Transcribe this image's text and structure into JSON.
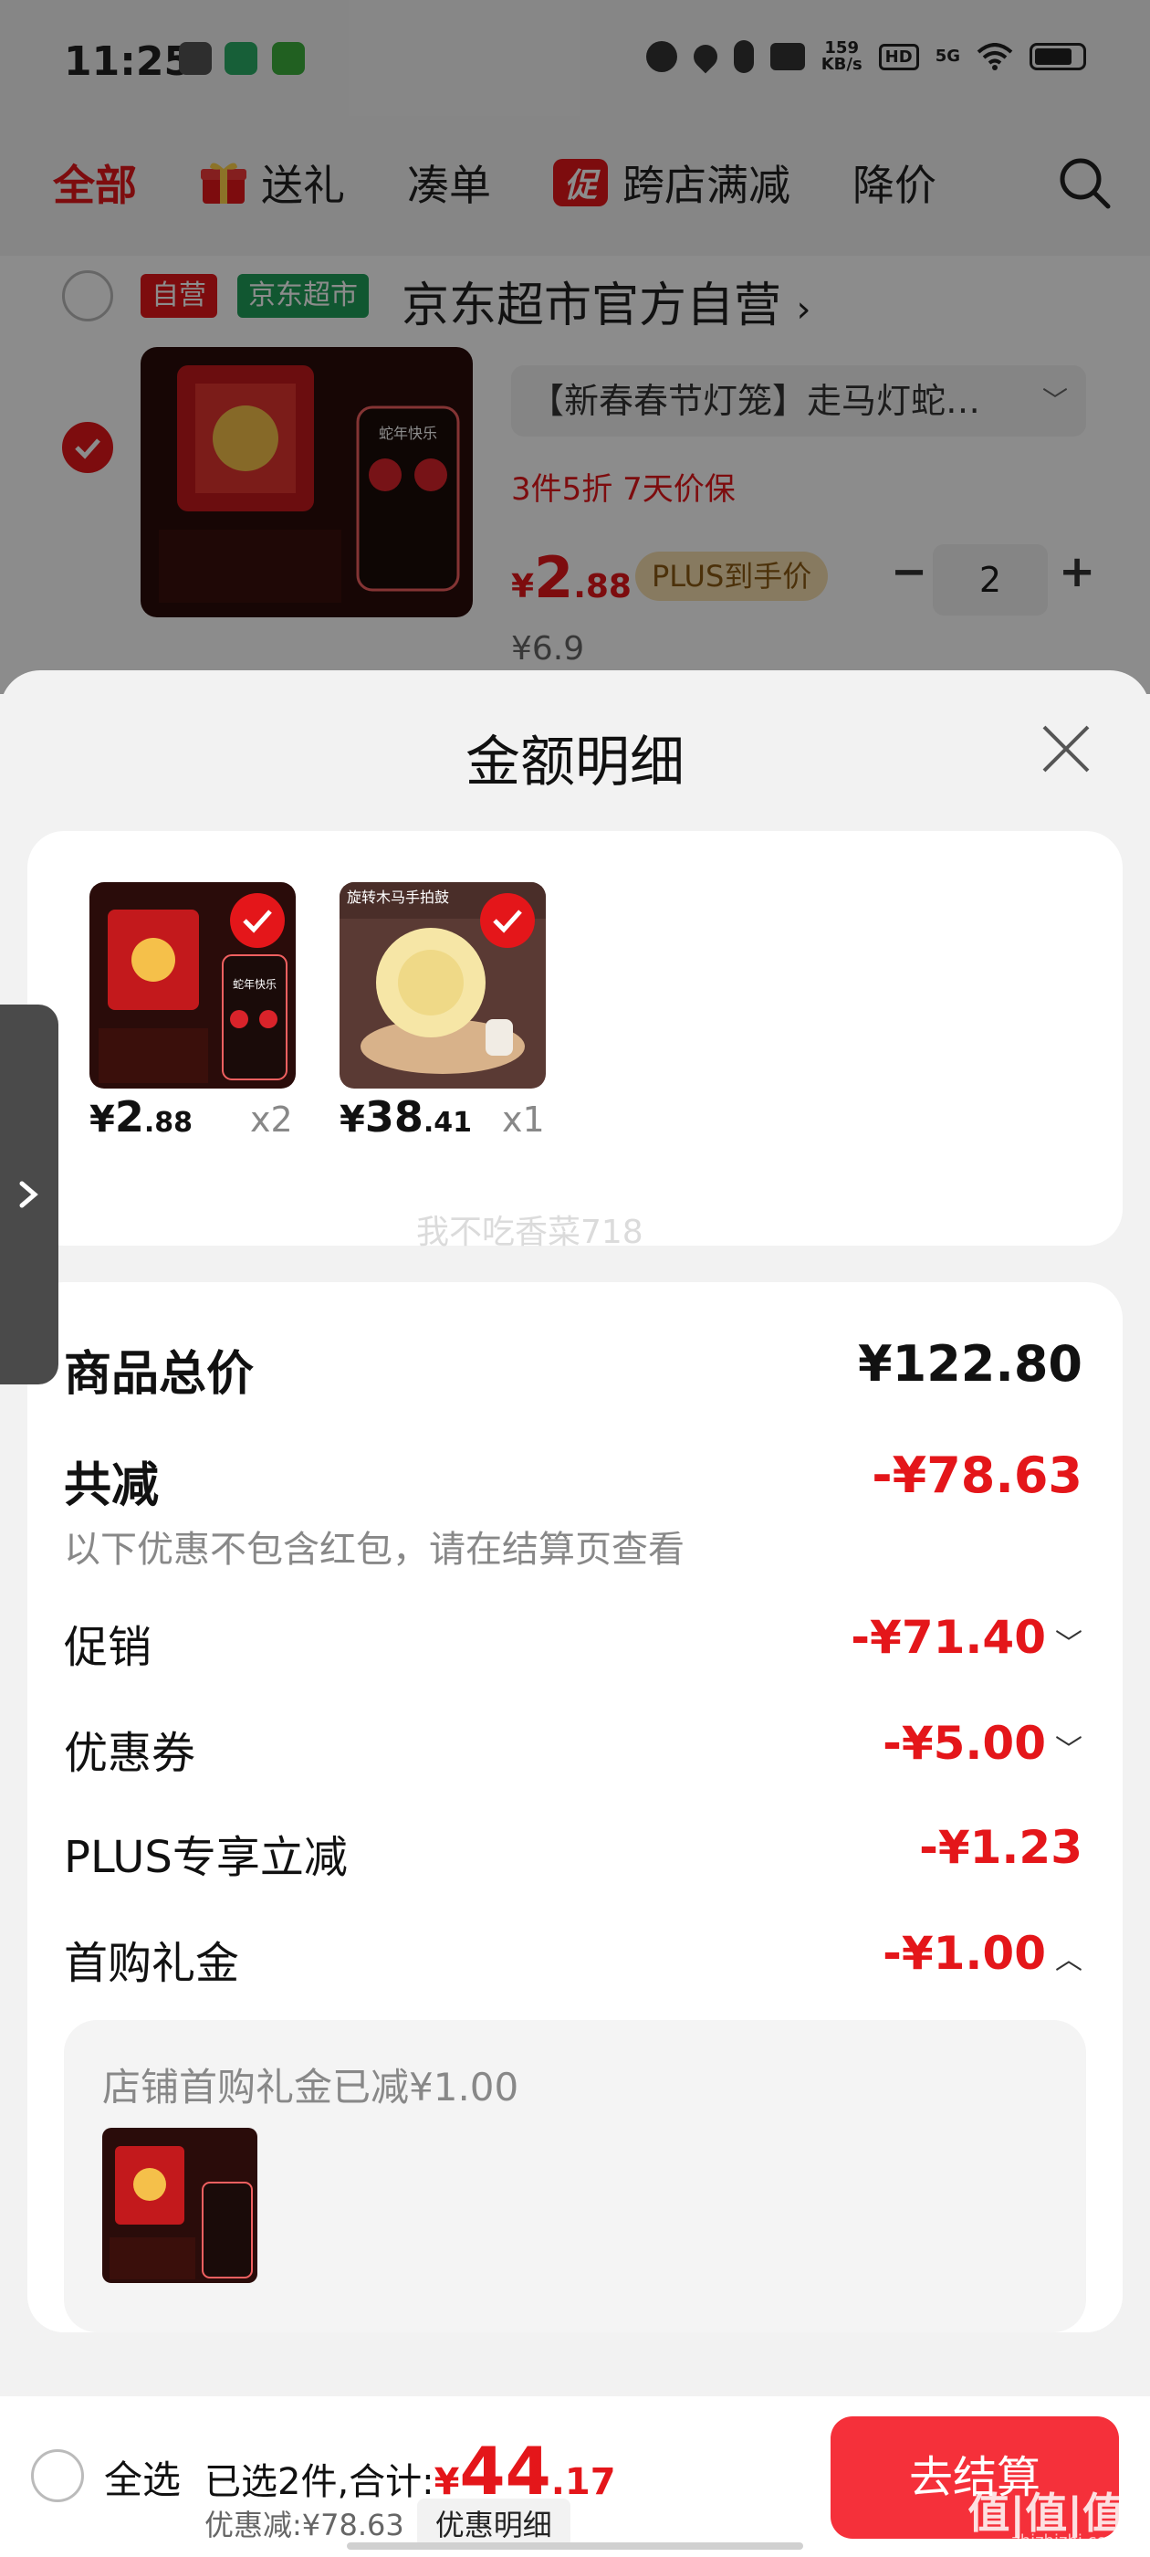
{
  "status_bar": {
    "time": "11:25",
    "net_speed_value": "159",
    "net_speed_unit": "KB/s",
    "hd": "HD",
    "signal": "5G"
  },
  "top_tabs": [
    {
      "label": "全部",
      "active": true
    },
    {
      "label": "送礼",
      "icon": "gift-icon"
    },
    {
      "label": "凑单"
    },
    {
      "label": "跨店满减",
      "badge": "促"
    },
    {
      "label": "降价"
    }
  ],
  "store": {
    "tag_self": "自营",
    "tag_market": "京东超市",
    "name": "京东超市官方自营",
    "chevron": "›"
  },
  "cart_item": {
    "title": "【新春春节灯笼】走马灯蛇…",
    "tags": "3件5折  7天价保",
    "price_symbol": "¥",
    "price_int": "2",
    "price_dec": ".88",
    "plus_tag": "PLUS到手价",
    "quantity": "2",
    "minus": "−",
    "plus": "+",
    "original_price": "¥6.9",
    "image_caption": "蛇年快乐"
  },
  "sheet": {
    "title": "金额明细",
    "watermark": "我不吃香菜718",
    "products": [
      {
        "price_symbol": "¥",
        "price_int": "2",
        "price_dec": ".88",
        "qty": "x2",
        "image_caption": "蛇年快乐"
      },
      {
        "price_symbol": "¥",
        "price_int": "38",
        "price_dec": ".41",
        "qty": "x1",
        "image_caption": "旋转木马手拍鼓"
      }
    ],
    "total_label": "商品总价",
    "total_value": "¥122.80",
    "discount_label": "共减",
    "discount_value": "-¥78.63",
    "discount_note": "以下优惠不包含红包，请在结算页查看",
    "rows": [
      {
        "label": "促销",
        "value": "-¥71.40",
        "chevron": "﹀"
      },
      {
        "label": "优惠券",
        "value": "-¥5.00",
        "chevron": "﹀"
      },
      {
        "label": "PLUS专享立减",
        "value": "-¥1.23"
      },
      {
        "label": "首购礼金",
        "value": "-¥1.00",
        "chevron": "︿"
      }
    ],
    "gift_note": "店铺首购礼金已减¥1.00"
  },
  "bottom_bar": {
    "select_all": "全选",
    "selected_text": "已选2件,合计:",
    "total_symbol": "¥",
    "total_int": "44",
    "total_dec": ".17",
    "saving_text": "优惠减:¥78.63",
    "detail_button": "优惠明细",
    "checkout_button": "去结算",
    "logo_text": "值|值|值",
    "logo_sub": "zhizhizhi.com"
  },
  "colors": {
    "accent": "#e4161a",
    "checkout": "#f5303a",
    "plus_tag_bg": "#f6dfb0"
  }
}
